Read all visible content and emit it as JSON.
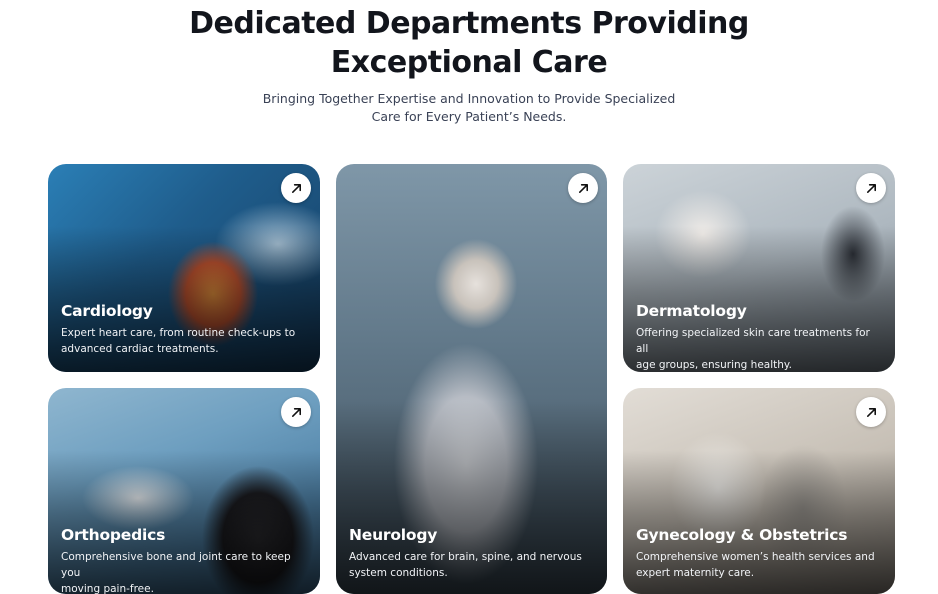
{
  "header": {
    "title_line1": "Dedicated Departments Providing",
    "title_line2": "Exceptional Care",
    "subtitle_line1": "Bringing Together Expertise and Innovation to Provide Specialized",
    "subtitle_line2": "Care for Every Patient’s Needs."
  },
  "departments": [
    {
      "name": "Cardiology",
      "desc_line1": "Expert heart care, from routine check-ups to",
      "desc_line2": "advanced cardiac treatments.",
      "icon": "arrow-up-right-icon"
    },
    {
      "name": "Neurology",
      "desc_line1": "Advanced care for brain, spine, and nervous",
      "desc_line2": "system conditions.",
      "icon": "arrow-up-right-icon"
    },
    {
      "name": "Dermatology",
      "desc_line1": "Offering specialized skin care treatments for all",
      "desc_line2": "age groups, ensuring healthy.",
      "icon": "arrow-up-right-icon"
    },
    {
      "name": "Orthopedics",
      "desc_line1": "Comprehensive bone and joint care to keep you",
      "desc_line2": "moving pain-free.",
      "icon": "arrow-up-right-icon"
    },
    {
      "name": "Gynecology & Obstetrics",
      "desc_line1": "Comprehensive women’s health services and",
      "desc_line2": "expert maternity care.",
      "icon": "arrow-up-right-icon"
    }
  ],
  "colors": {
    "heading": "#12151c",
    "subtitle": "#3a4256",
    "card_text": "#ffffff"
  }
}
